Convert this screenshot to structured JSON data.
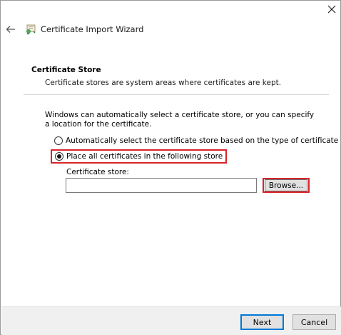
{
  "window": {
    "title": "Certificate Import Wizard"
  },
  "section": {
    "heading": "Certificate Store",
    "description": "Certificate stores are system areas where certificates are kept."
  },
  "intro_text": "Windows can automatically select a certificate store, or you can specify a location for the certificate.",
  "options": {
    "auto_label": "Automatically select the certificate store based on the type of certificate",
    "place_label": "Place all certificates in the following store",
    "selected": "place"
  },
  "store": {
    "label": "Certificate store:",
    "value": "",
    "browse_label": "Browse..."
  },
  "footer": {
    "next_label": "Next",
    "cancel_label": "Cancel"
  },
  "colors": {
    "highlight": "#d9242b",
    "focus": "#0078d7"
  },
  "icons": {
    "close": "close-icon",
    "back": "back-arrow-icon",
    "wizard": "certificate-icon"
  }
}
